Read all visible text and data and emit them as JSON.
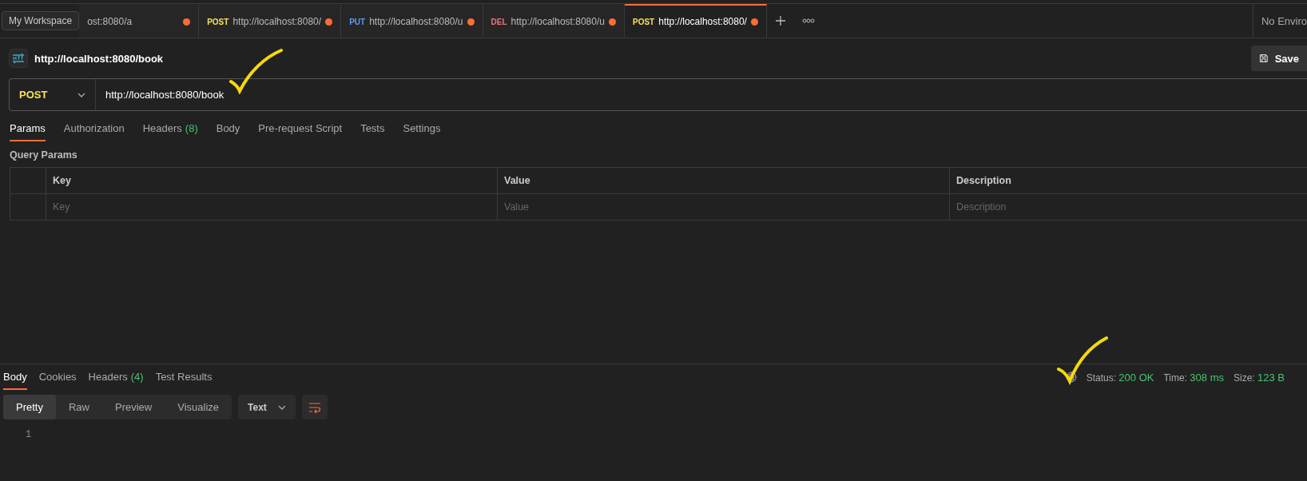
{
  "workspace": {
    "label": "My Workspace"
  },
  "tabs": [
    {
      "url": "ost:8080/a",
      "unsaved": true,
      "selected": false
    },
    {
      "method": "POST",
      "url": "http://localhost:8080/",
      "unsaved": true,
      "selected": false
    },
    {
      "method": "PUT",
      "url": "http://localhost:8080/u",
      "unsaved": true,
      "selected": false
    },
    {
      "method": "DEL",
      "url": "http://localhost:8080/u",
      "unsaved": true,
      "selected": false
    },
    {
      "method": "POST",
      "url": "http://localhost:8080/",
      "unsaved": true,
      "selected": true
    }
  ],
  "environment": "No Enviro",
  "request": {
    "title": "http://localhost:8080/book",
    "save_label": "Save",
    "method": "POST",
    "url": "http://localhost:8080/book"
  },
  "request_tabs": [
    {
      "label": "Params",
      "selected": true
    },
    {
      "label": "Authorization",
      "selected": false
    },
    {
      "label": "Headers",
      "count": "(8)",
      "selected": false
    },
    {
      "label": "Body",
      "selected": false
    },
    {
      "label": "Pre-request Script",
      "selected": false
    },
    {
      "label": "Tests",
      "selected": false
    },
    {
      "label": "Settings",
      "selected": false
    }
  ],
  "query_params": {
    "title": "Query Params",
    "columns": [
      "Key",
      "Value",
      "Description"
    ],
    "placeholders": [
      "Key",
      "Value",
      "Description"
    ]
  },
  "response_tabs": [
    {
      "label": "Body",
      "selected": true
    },
    {
      "label": "Cookies",
      "selected": false
    },
    {
      "label": "Headers",
      "count": "(4)",
      "selected": false
    },
    {
      "label": "Test Results",
      "selected": false
    }
  ],
  "response_status": [
    {
      "label": "Status:",
      "value": "200 OK"
    },
    {
      "label": "Time:",
      "value": "308 ms"
    },
    {
      "label": "Size:",
      "value": "123 B"
    }
  ],
  "view_modes": [
    {
      "label": "Pretty",
      "selected": true
    },
    {
      "label": "Raw",
      "selected": false
    },
    {
      "label": "Preview",
      "selected": false
    },
    {
      "label": "Visualize",
      "selected": false
    }
  ],
  "format": "Text",
  "line_numbers": [
    "1"
  ]
}
